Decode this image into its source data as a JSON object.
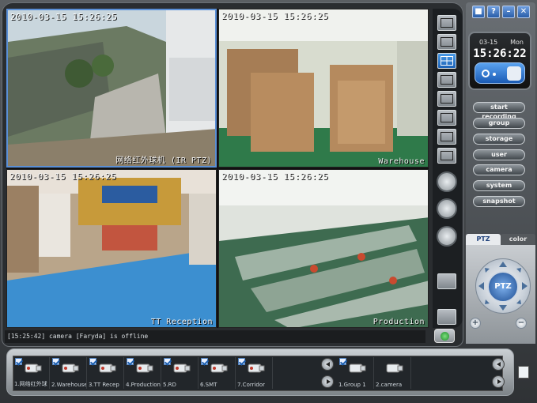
{
  "cameras": [
    {
      "timestamp": "2010-03-15 15:26:25",
      "name": "网络红外球机 (IR PTZ)"
    },
    {
      "timestamp": "2010-03-15 15:26:25",
      "name": "Warehouse"
    },
    {
      "timestamp": "2010-03-15 15:26:25",
      "name": "TT Reception"
    },
    {
      "timestamp": "2010-03-15 15:26:25",
      "name": "Production"
    }
  ],
  "status": {
    "message": "[15:25:42]   camera [Faryda] is offline"
  },
  "clock": {
    "date": "03-15",
    "weekday": "Mon",
    "time": "15:26:22"
  },
  "menu": {
    "start_recording": "start recording",
    "group": "group",
    "storage": "storage",
    "user": "user",
    "camera": "camera",
    "system": "system",
    "snapshot": "snapshot"
  },
  "tabs": {
    "ptz": "PTZ",
    "color": "color"
  },
  "ptz": {
    "center_label": "PTZ"
  },
  "top_icons": {
    "help": "?",
    "minimize": "–",
    "close": "✕"
  },
  "camera_list": [
    {
      "label": "1.网络红外球"
    },
    {
      "label": "2.Warehouse"
    },
    {
      "label": "3.TT Recep"
    },
    {
      "label": "4.Production"
    },
    {
      "label": "5.RD"
    },
    {
      "label": "6.SMT"
    },
    {
      "label": "7.Corridor"
    }
  ],
  "group_list": [
    {
      "label": "1.Group 1"
    },
    {
      "label": "2.camera"
    }
  ],
  "colors": {
    "accent": "#1d62b6",
    "selected_border": "#5a8fd6"
  }
}
